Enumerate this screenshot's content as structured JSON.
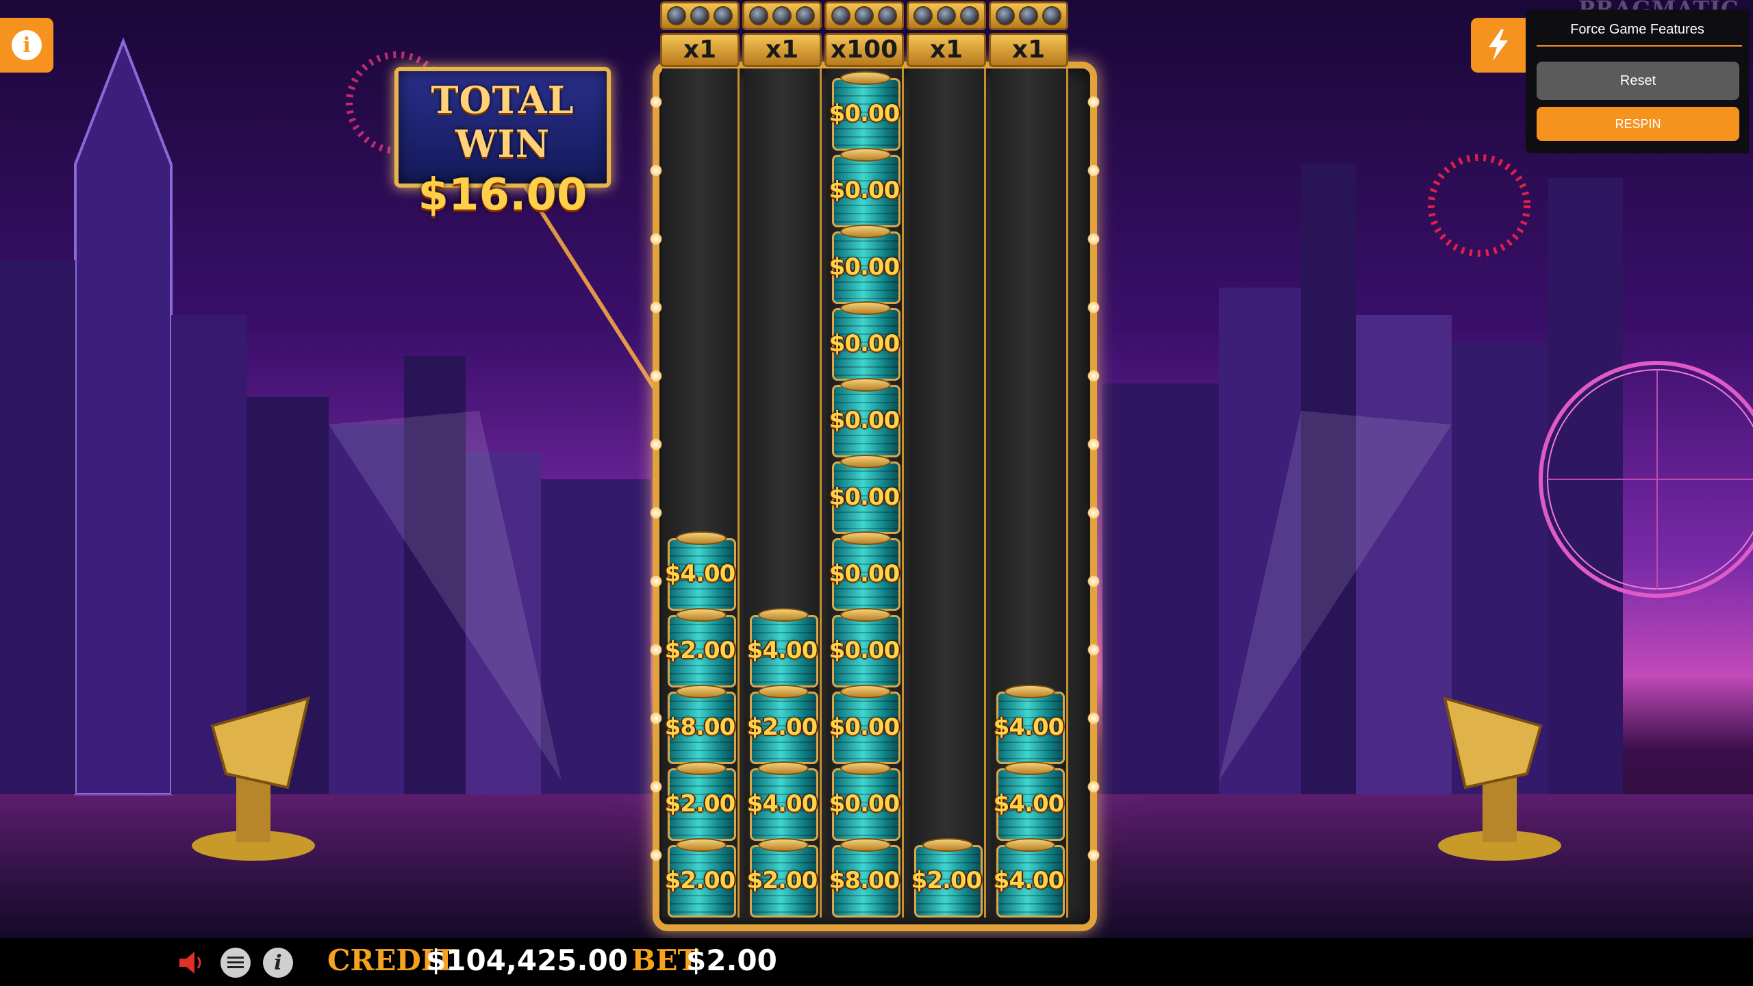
{
  "brand": {
    "logo_text": "PRAGMATIC PLAY"
  },
  "top_left": {
    "info_icon": "info-icon"
  },
  "force_features": {
    "icon": "lightning-bolt-icon",
    "title": "Force Game Features",
    "reset_label": "Reset",
    "respin_label": "RESPIN"
  },
  "total_win": {
    "label": "TOTAL WIN",
    "value": "$16.00"
  },
  "reels": [
    {
      "multiplier": "x1",
      "cells": [
        "$4.00",
        "$2.00",
        "$8.00",
        "$2.00",
        "$2.00"
      ]
    },
    {
      "multiplier": "x1",
      "cells": [
        "$4.00",
        "$2.00",
        "$4.00",
        "$2.00"
      ]
    },
    {
      "multiplier": "x100",
      "cells": [
        "$0.00",
        "$0.00",
        "$0.00",
        "$0.00",
        "$0.00",
        "$0.00",
        "$0.00",
        "$0.00",
        "$0.00",
        "$0.00",
        "$8.00"
      ]
    },
    {
      "multiplier": "x1",
      "cells": [
        "$2.00"
      ]
    },
    {
      "multiplier": "x1",
      "cells": [
        "$4.00",
        "$4.00",
        "$4.00"
      ]
    }
  ],
  "bottom_bar": {
    "sound_icon": "speaker-icon",
    "menu_icon": "menu-icon",
    "info_icon": "info-icon",
    "credit_label": "CREDIT",
    "credit_value": "$104,425.00",
    "bet_label": "BET",
    "bet_value": "$2.00"
  },
  "colors": {
    "accent_orange": "#f6921e",
    "gold": "#e2a43a",
    "panel_dark": "#0e0e12"
  }
}
